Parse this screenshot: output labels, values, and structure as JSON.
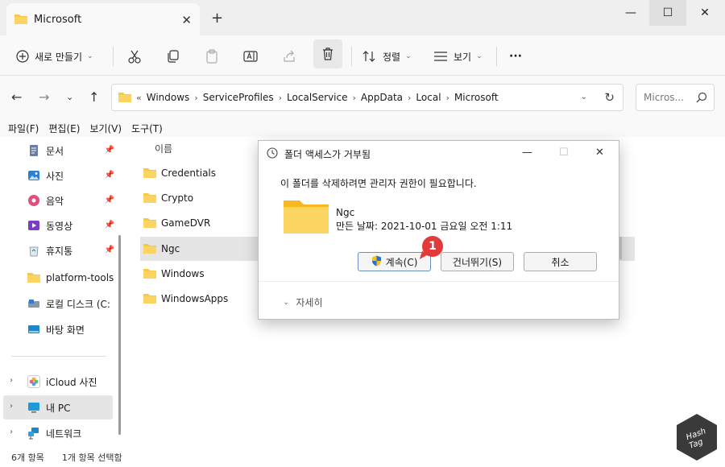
{
  "window": {
    "tab_title": "Microsoft",
    "new_tab": "+",
    "min": "—",
    "max": "☐",
    "close": "✕"
  },
  "toolbar": {
    "new_label": "새로 만들기",
    "sort_label": "정렬",
    "view_label": "보기",
    "more_label": "···"
  },
  "address": {
    "overflow": "«",
    "crumbs": [
      "Windows",
      "ServiceProfiles",
      "LocalService",
      "AppData",
      "Local",
      "Microsoft"
    ],
    "search_placeholder": "Micros..."
  },
  "menubar": [
    "파일(F)",
    "편집(E)",
    "보기(V)",
    "도구(T)"
  ],
  "sidebar": {
    "items": [
      {
        "label": "문서",
        "icon": "document-icon",
        "pinned": true
      },
      {
        "label": "사진",
        "icon": "picture-icon",
        "pinned": true
      },
      {
        "label": "음악",
        "icon": "music-icon",
        "pinned": true
      },
      {
        "label": "동영상",
        "icon": "video-icon",
        "pinned": true
      },
      {
        "label": "휴지통",
        "icon": "recycle-bin-icon",
        "pinned": true
      },
      {
        "label": "platform-tools",
        "icon": "folder-icon",
        "pinned": false
      },
      {
        "label": "로컬 디스크 (C:",
        "icon": "drive-icon",
        "pinned": false
      },
      {
        "label": "바탕 화면",
        "icon": "desktop-icon",
        "pinned": false
      }
    ],
    "tree": [
      {
        "label": "iCloud 사진",
        "icon": "icloud-photos-icon"
      },
      {
        "label": "내 PC",
        "icon": "pc-icon"
      },
      {
        "label": "네트워크",
        "icon": "network-icon"
      }
    ]
  },
  "filelist": {
    "column_name": "이름",
    "files": [
      "Credentials",
      "Crypto",
      "GameDVR",
      "Ngc",
      "Windows",
      "WindowsApps"
    ]
  },
  "statusbar": {
    "count": "6개 항목",
    "selected": "1개 항목 선택함"
  },
  "dialog": {
    "title": "폴더 액세스가 거부됨",
    "message": "이 폴더를 삭제하려면 관리자 권한이 필요합니다.",
    "folder_name": "Ngc",
    "folder_date": "만든 날짜: 2021-10-01 금요일 오전 1:11",
    "continue_label": "계속(C)",
    "skip_label": "건너뛰기(S)",
    "cancel_label": "취소",
    "details_label": "자세히",
    "min": "—",
    "max": "☐",
    "close": "✕"
  },
  "annotation": {
    "step": "1",
    "color": "#e23a3a"
  },
  "colors": {
    "folder": "#f8c84a",
    "accent": "#0067c0"
  }
}
